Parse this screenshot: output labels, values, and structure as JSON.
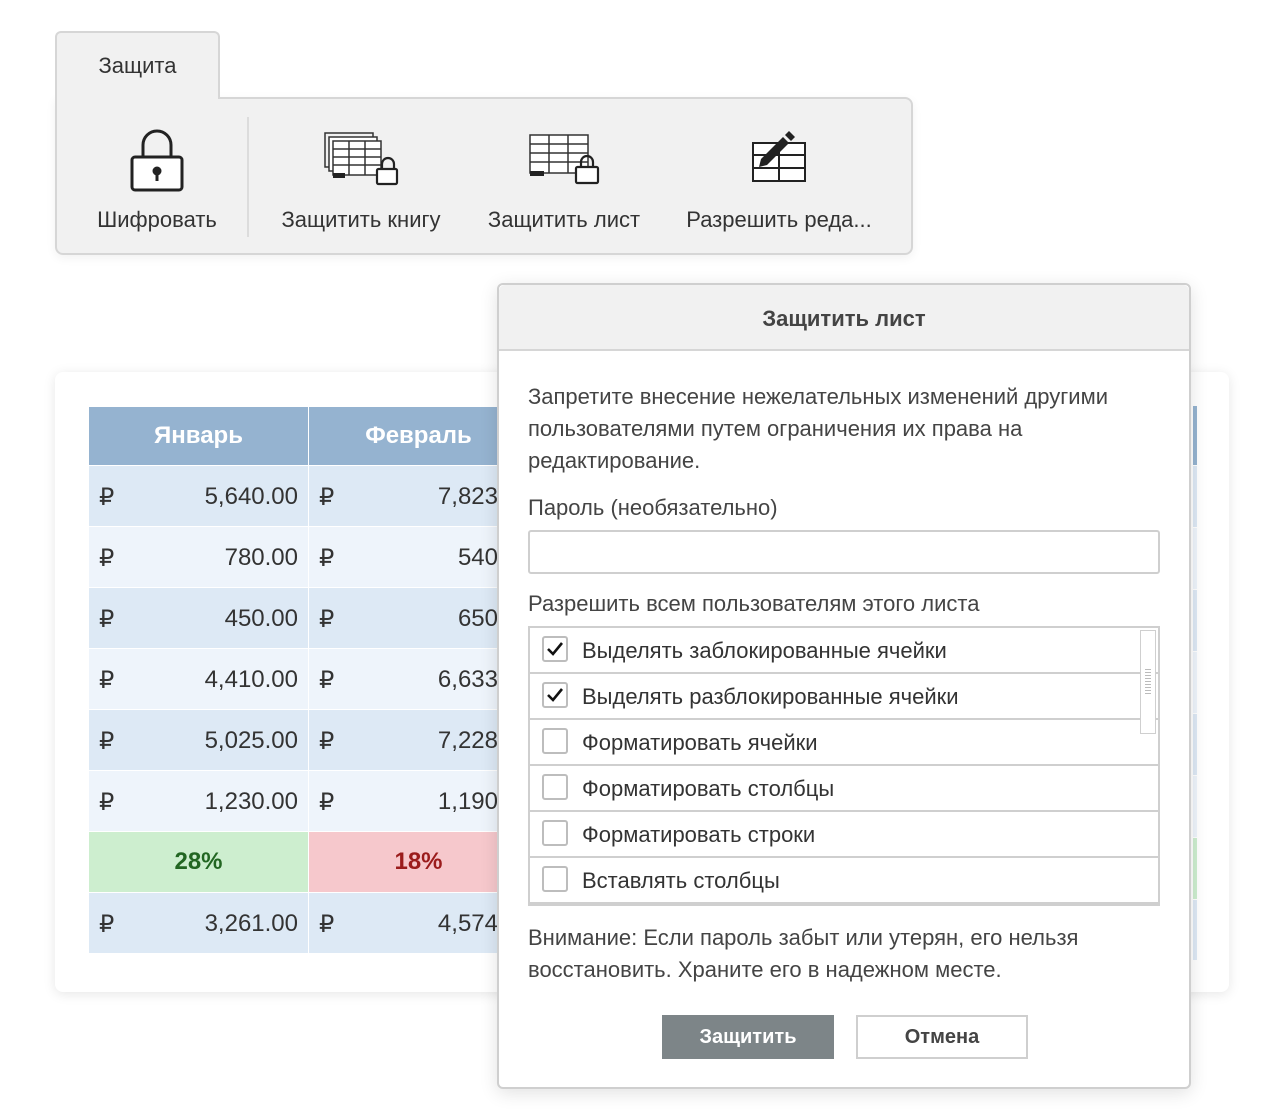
{
  "ribbon": {
    "tab_label": "Защита",
    "buttons": [
      {
        "label": "Шифровать",
        "icon": "padlock-icon"
      },
      {
        "label": "Защитить книгу",
        "icon": "protect-workbook-icon"
      },
      {
        "label": "Защитить лист",
        "icon": "protect-sheet-icon"
      },
      {
        "label": "Разрешить реда...",
        "icon": "allow-edit-ranges-icon"
      }
    ]
  },
  "sheet": {
    "headers": [
      "Январь",
      "Февраль"
    ],
    "rows": [
      {
        "currency": "₽",
        "values": [
          "5,640.00",
          "7,823.0"
        ]
      },
      {
        "currency": "₽",
        "values": [
          "780.00",
          "540.0"
        ]
      },
      {
        "currency": "₽",
        "values": [
          "450.00",
          "650.0"
        ]
      },
      {
        "currency": "₽",
        "values": [
          "4,410.00",
          "6,633.0"
        ]
      },
      {
        "currency": "₽",
        "values": [
          "5,025.00",
          "7,228.0"
        ]
      },
      {
        "currency": "₽",
        "values": [
          "1,230.00",
          "1,190.0"
        ]
      }
    ],
    "percent_row": [
      "28%",
      "18%"
    ],
    "total_row": {
      "currency": "₽",
      "values": [
        "3,261.00",
        "4,574.0"
      ]
    },
    "colors": {
      "header": "#95b3d0",
      "row_dark": "#dde9f5",
      "row_light": "#eef4fb",
      "positive": "#cdeecf",
      "negative": "#f6c8cc"
    }
  },
  "dialog": {
    "title": "Защитить лист",
    "description": "Запретите внесение нежелательных изменений другими пользователями путем ограничения их права на редактирование.",
    "password_label": "Пароль (необязательно)",
    "password_value": "",
    "permissions_label": "Разрешить всем пользователям этого листа",
    "permissions": [
      {
        "label": "Выделять заблокированные ячейки",
        "checked": true
      },
      {
        "label": "Выделять разблокированные ячейки",
        "checked": true
      },
      {
        "label": "Форматировать ячейки",
        "checked": false
      },
      {
        "label": "Форматировать столбцы",
        "checked": false
      },
      {
        "label": "Форматировать строки",
        "checked": false
      },
      {
        "label": "Вставлять столбцы",
        "checked": false
      }
    ],
    "warning": "Внимание: Если пароль забыт или утерян, его нельзя восстановить. Храните его в надежном месте.",
    "protect_button": "Защитить",
    "cancel_button": "Отмена"
  }
}
